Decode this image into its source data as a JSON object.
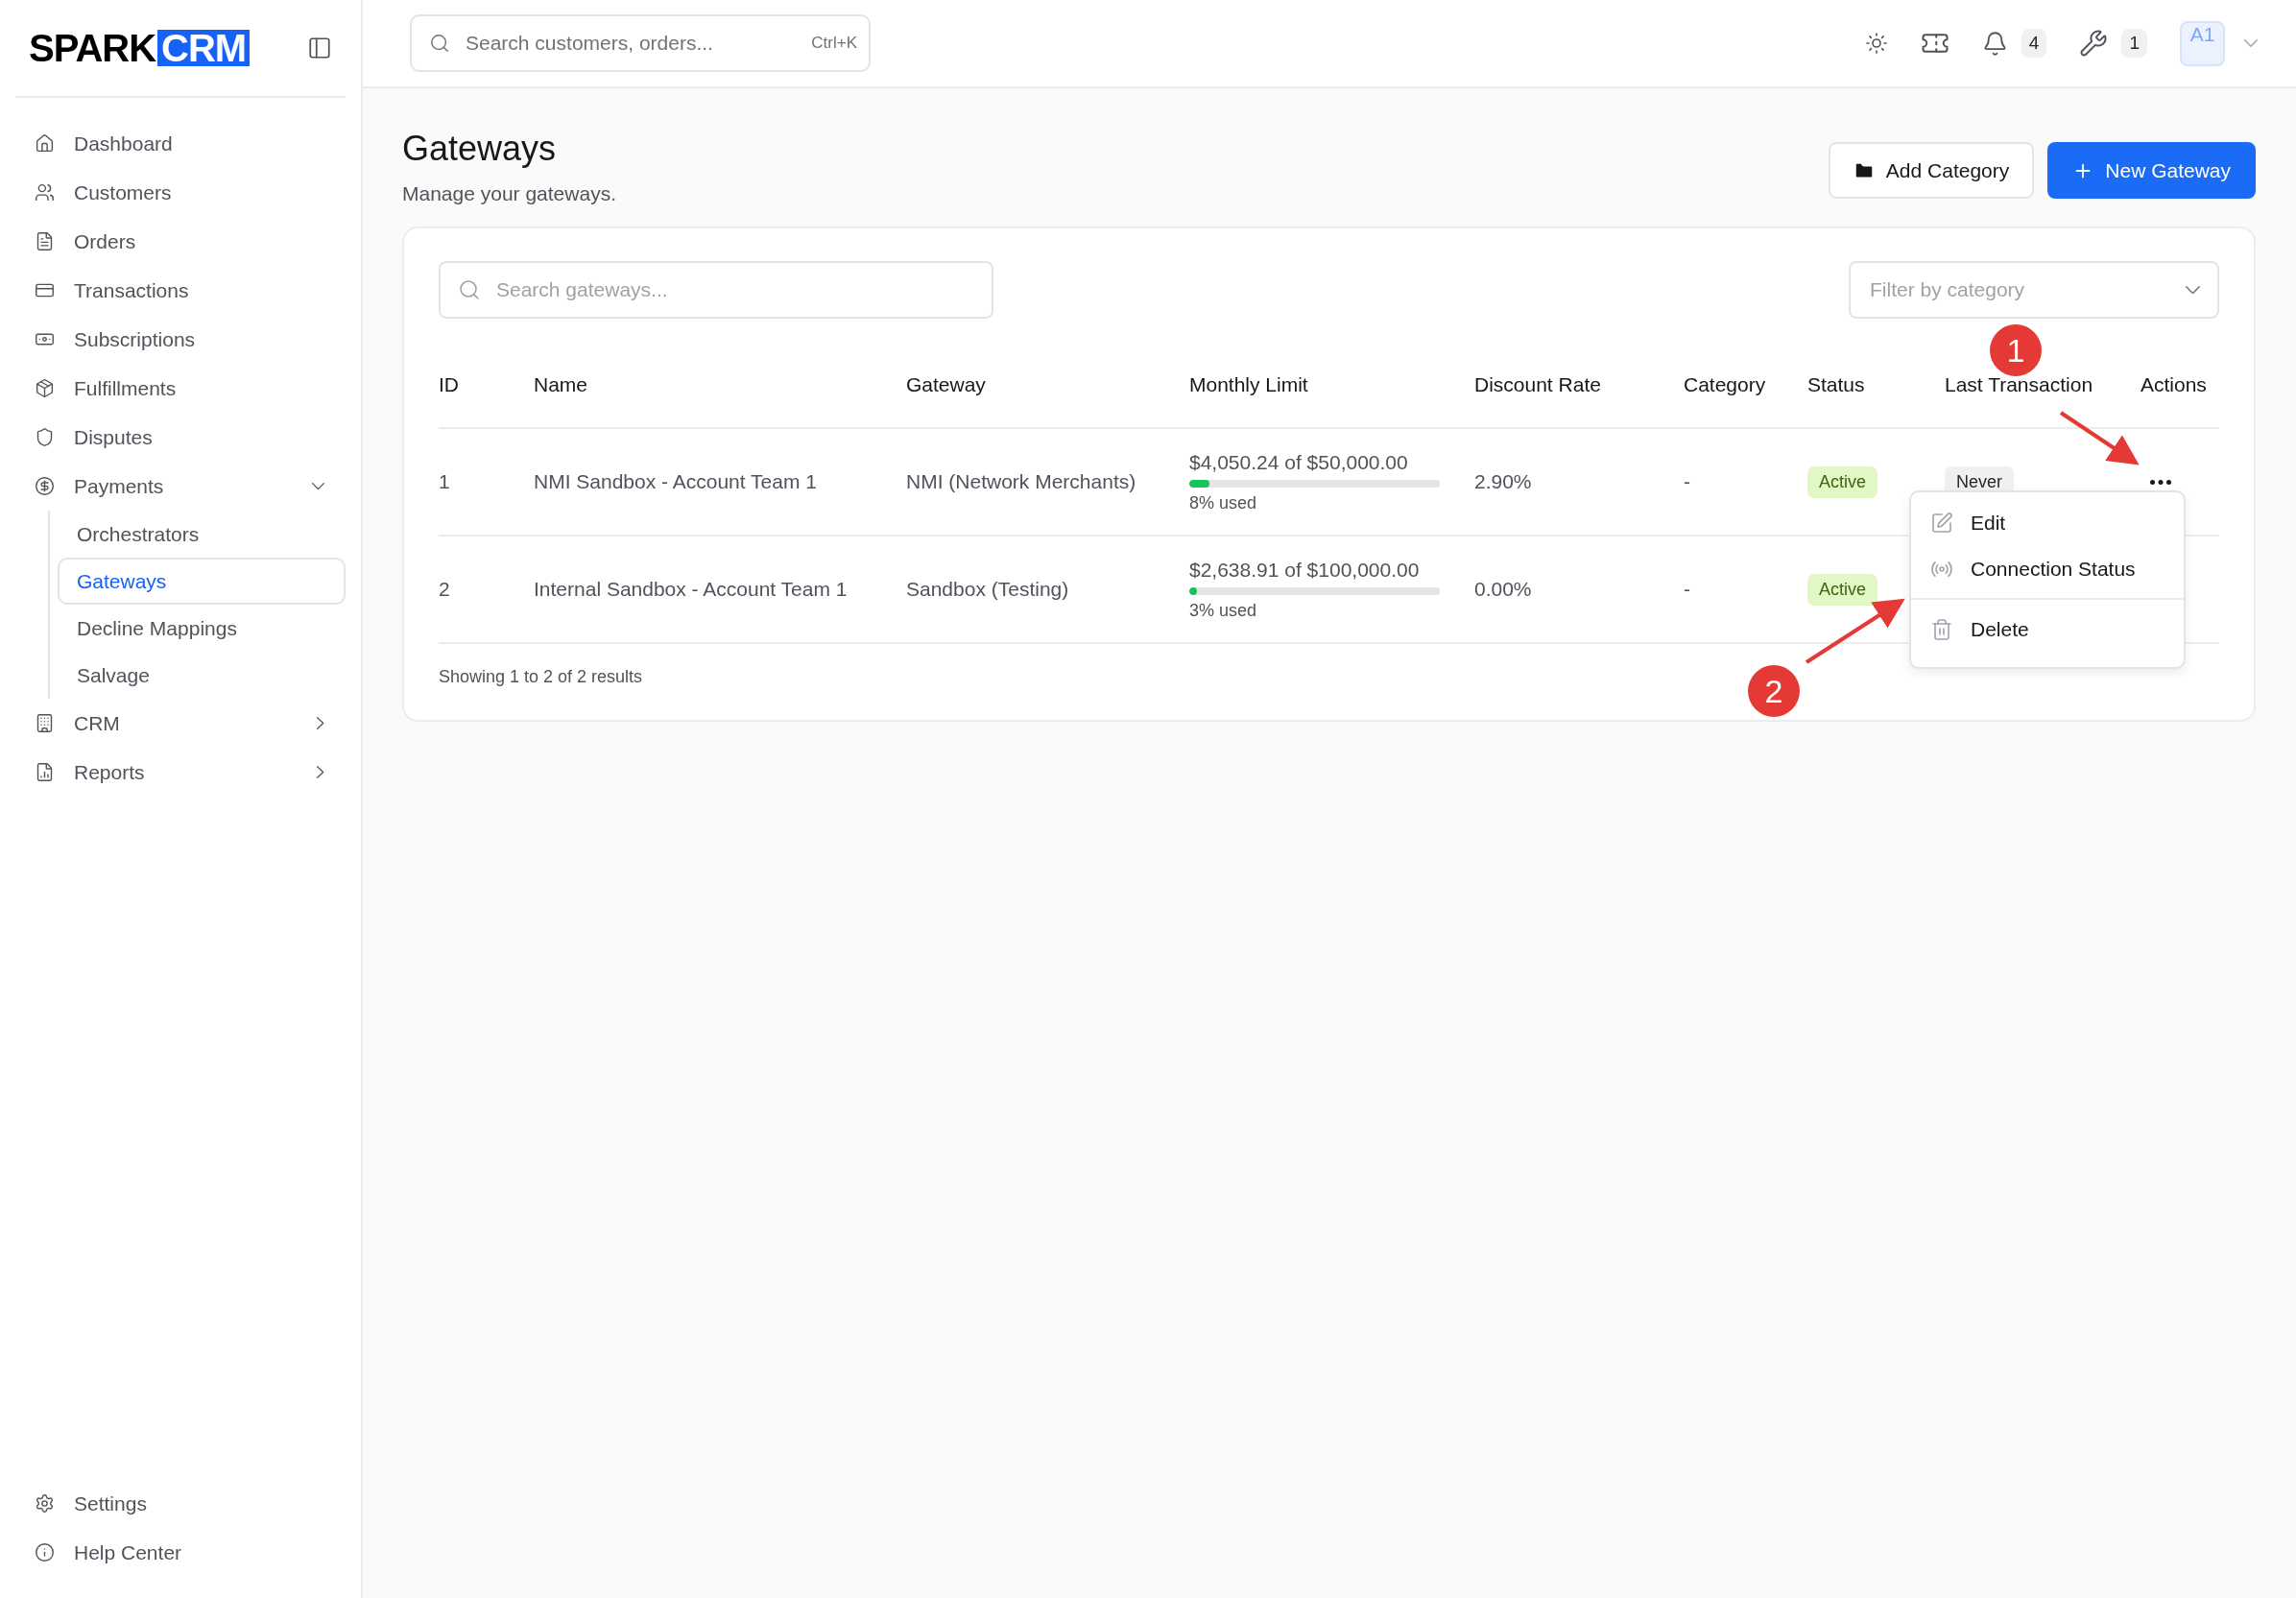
{
  "logo": {
    "word": "SPARK",
    "badge": "CRM"
  },
  "sidebar": {
    "items": [
      {
        "label": "Dashboard",
        "selected": false
      },
      {
        "label": "Customers",
        "selected": false
      },
      {
        "label": "Orders",
        "selected": false
      },
      {
        "label": "Transactions",
        "selected": false
      },
      {
        "label": "Subscriptions",
        "selected": false
      },
      {
        "label": "Fulfillments",
        "selected": false
      },
      {
        "label": "Disputes",
        "selected": false
      },
      {
        "label": "Payments",
        "selected": false,
        "expanded": true,
        "children": [
          {
            "label": "Orchestrators",
            "selected": false
          },
          {
            "label": "Gateways",
            "selected": true
          },
          {
            "label": "Decline Mappings",
            "selected": false
          },
          {
            "label": "Salvage",
            "selected": false
          }
        ]
      },
      {
        "label": "CRM",
        "selected": false,
        "expanded": false
      },
      {
        "label": "Reports",
        "selected": false,
        "expanded": false
      }
    ],
    "footer": [
      {
        "label": "Settings"
      },
      {
        "label": "Help Center"
      }
    ]
  },
  "topbar": {
    "search": {
      "placeholder": "Search customers, orders...",
      "shortcut": "Ctrl+K"
    },
    "notifications": "4",
    "tools": "1",
    "avatar": "A1"
  },
  "page": {
    "title": "Gateways",
    "subtitle": "Manage your gateways.",
    "buttons": [
      {
        "label": "Add Category",
        "kind": "secondary"
      },
      {
        "label": "New Gateway",
        "kind": "primary"
      }
    ]
  },
  "filters": {
    "search": {
      "placeholder": "Search gateways..."
    },
    "category": {
      "placeholder": "Filter by category"
    }
  },
  "table": {
    "columns": [
      "ID",
      "Name",
      "Gateway",
      "Monthly Limit",
      "Discount Rate",
      "Category",
      "Status",
      "Last Transaction",
      "Actions"
    ],
    "rows": [
      {
        "id": "1",
        "name": "NMI Sandbox - Account Team 1",
        "gateway": "NMI (Network Merchants)",
        "limit": "$4,050.24 of $50,000.00",
        "level": 0.08,
        "used": "8% used",
        "rate": "2.90%",
        "category": "-",
        "status": "Active",
        "last": "Never",
        "menu": {
          "items": [
            {
              "label": "Edit",
              "kind": "edit"
            },
            {
              "label": "Connection Status",
              "kind": "signal"
            },
            {
              "label": "Delete",
              "kind": "delete"
            }
          ]
        }
      },
      {
        "id": "2",
        "name": "Internal Sandbox - Account Team 1",
        "gateway": "Sandbox (Testing)",
        "limit": "$2,638.91 of $100,000.00",
        "level": 0.03,
        "used": "3% used",
        "rate": "0.00%",
        "category": "-",
        "status": "Active"
      }
    ],
    "footer": "Showing 1 to 2 of 2 results"
  },
  "annotations": [
    {
      "label": "1"
    },
    {
      "label": "2"
    }
  ]
}
